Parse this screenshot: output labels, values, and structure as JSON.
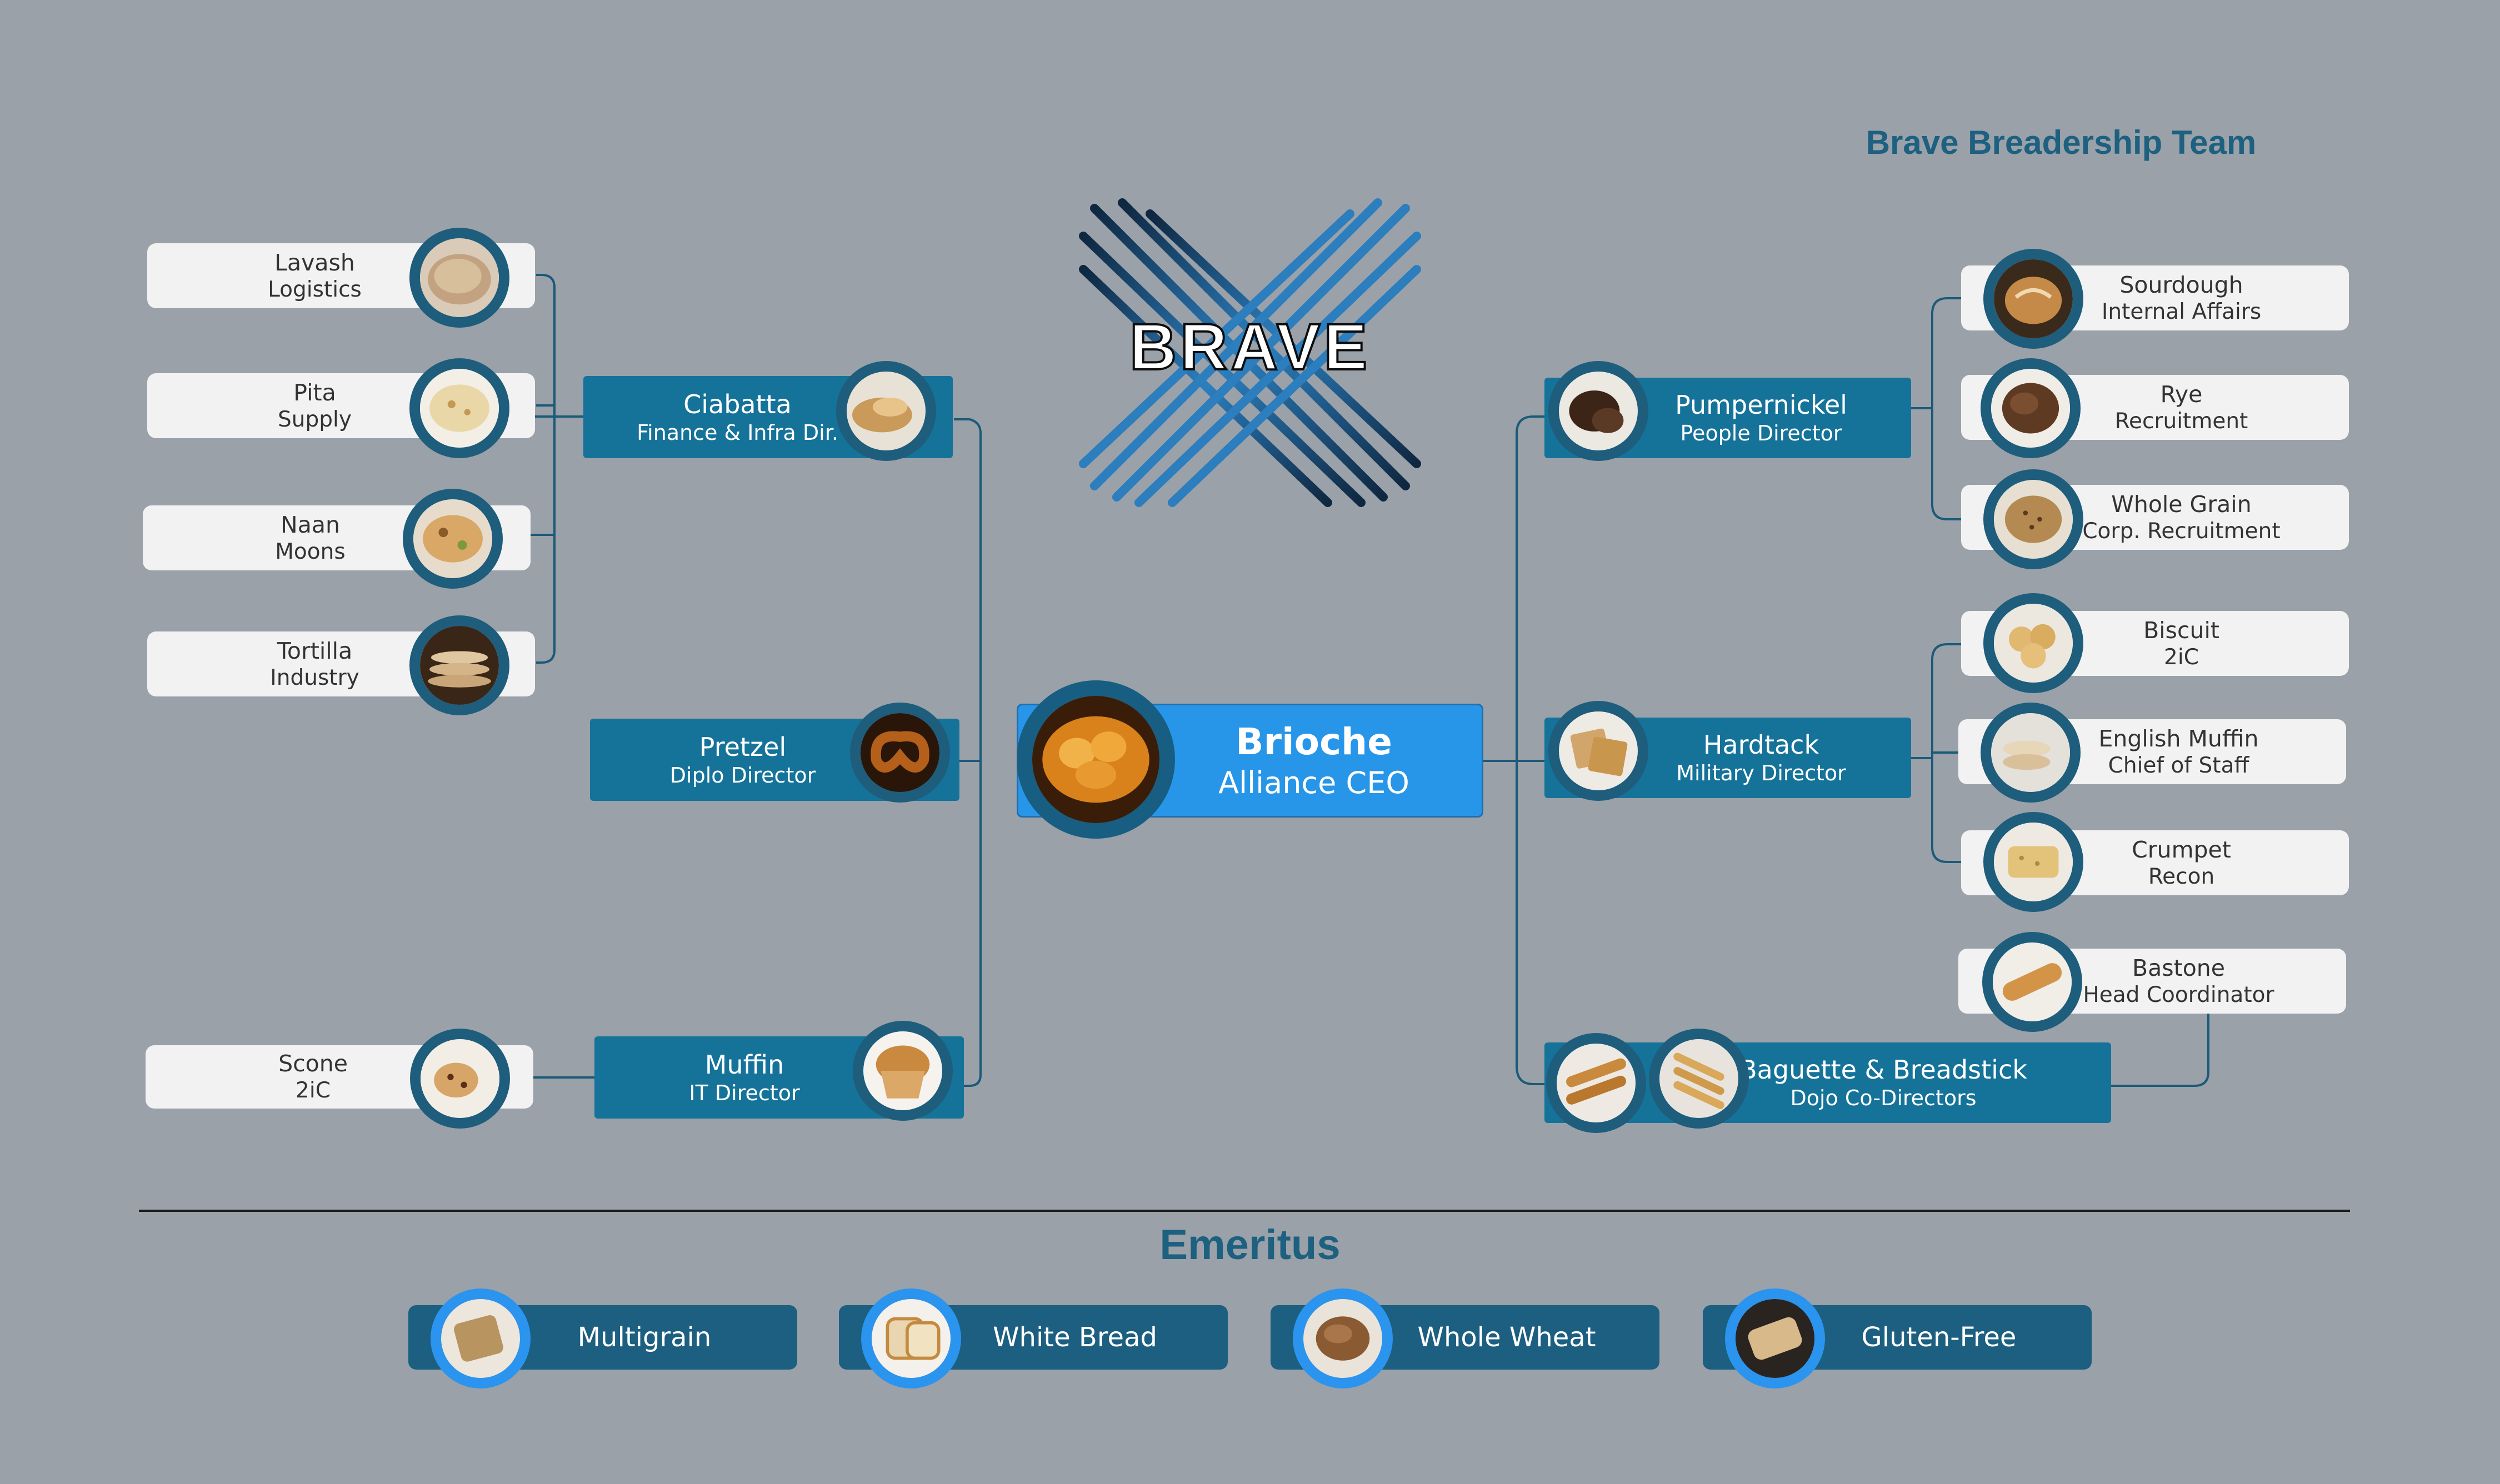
{
  "team_title": "Brave Breadership Team",
  "logo_text": "BRAVE",
  "ceo": {
    "name": "Brioche",
    "role": "Alliance CEO"
  },
  "directors": {
    "ciabatta": {
      "name": "Ciabatta",
      "role": "Finance & Infra Dir."
    },
    "pretzel": {
      "name": "Pretzel",
      "role": "Diplo Director"
    },
    "muffin": {
      "name": "Muffin",
      "role": "IT Director"
    },
    "pumpernickel": {
      "name": "Pumpernickel",
      "role": "People Director"
    },
    "hardtack": {
      "name": "Hardtack",
      "role": "Military Director"
    },
    "baguette": {
      "name": "Baguette & Breadstick",
      "role": "Dojo Co-Directors"
    }
  },
  "left_reports": {
    "lavash": {
      "name": "Lavash",
      "role": "Logistics"
    },
    "pita": {
      "name": "Pita",
      "role": "Supply"
    },
    "naan": {
      "name": "Naan",
      "role": "Moons"
    },
    "tortilla": {
      "name": "Tortilla",
      "role": "Industry"
    },
    "scone": {
      "name": "Scone",
      "role": "2iC"
    }
  },
  "right_reports": {
    "sourdough": {
      "name": "Sourdough",
      "role": "Internal Affairs"
    },
    "rye": {
      "name": "Rye",
      "role": "Recruitment"
    },
    "wholegrain": {
      "name": "Whole Grain",
      "role": "Corp. Recruitment"
    },
    "biscuit": {
      "name": "Biscuit",
      "role": "2iC"
    },
    "englishmuffin": {
      "name": "English Muffin",
      "role": "Chief of Staff"
    },
    "crumpet": {
      "name": "Crumpet",
      "role": "Recon"
    },
    "bastone": {
      "name": "Bastone",
      "role": "Head Coordinator"
    }
  },
  "emeritus": {
    "title": "Emeritus",
    "items": [
      {
        "name": "Multigrain"
      },
      {
        "name": "White Bread"
      },
      {
        "name": "Whole Wheat"
      },
      {
        "name": "Gluten-Free"
      }
    ]
  },
  "colors": {
    "background": "#9aa1a9",
    "teal_box": "#15739a",
    "ceo_box": "#2896e8",
    "photo_ring": "#1e5d7c",
    "emeritus_ring": "#2b94ee",
    "title": "#1d607f"
  }
}
